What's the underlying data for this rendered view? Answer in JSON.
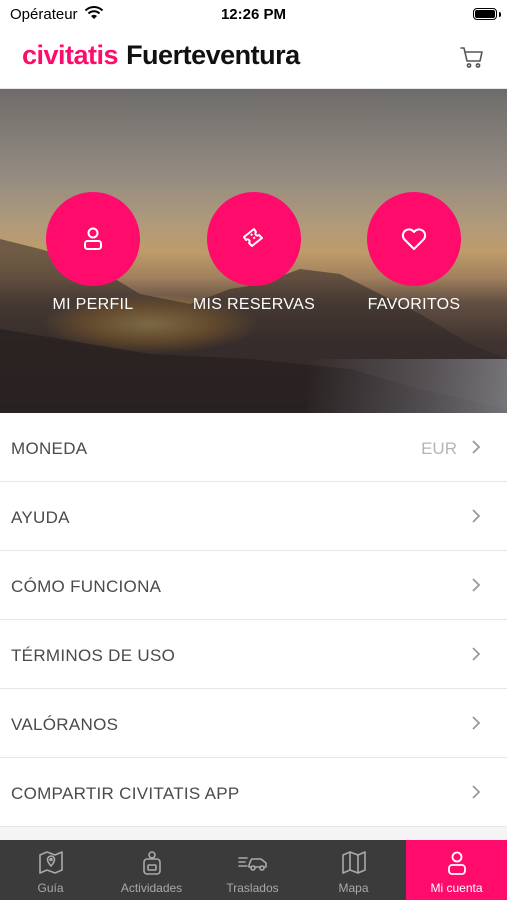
{
  "status_bar": {
    "carrier": "Opérateur",
    "time": "12:26 PM"
  },
  "header": {
    "brand": "civitatis",
    "city": "Fuerteventura"
  },
  "hero_tiles": [
    {
      "label": "MI PERFIL"
    },
    {
      "label": "MIS RESERVAS"
    },
    {
      "label": "FAVORITOS"
    }
  ],
  "menu": {
    "items": [
      {
        "label": "MONEDA",
        "value": "EUR"
      },
      {
        "label": "AYUDA"
      },
      {
        "label": "CÓMO FUNCIONA"
      },
      {
        "label": "TÉRMINOS DE USO"
      },
      {
        "label": "VALÓRANOS"
      },
      {
        "label": "COMPARTIR CIVITATIS APP"
      }
    ]
  },
  "tabbar": {
    "tabs": [
      {
        "label": "Guía"
      },
      {
        "label": "Actividades"
      },
      {
        "label": "Traslados"
      },
      {
        "label": "Mapa"
      },
      {
        "label": "Mi cuenta"
      }
    ],
    "active": "Mi cuenta"
  },
  "colors": {
    "accent": "#ff0b6c",
    "tabbar_bg": "#3b3b3b",
    "text": "#4a4a4a"
  }
}
